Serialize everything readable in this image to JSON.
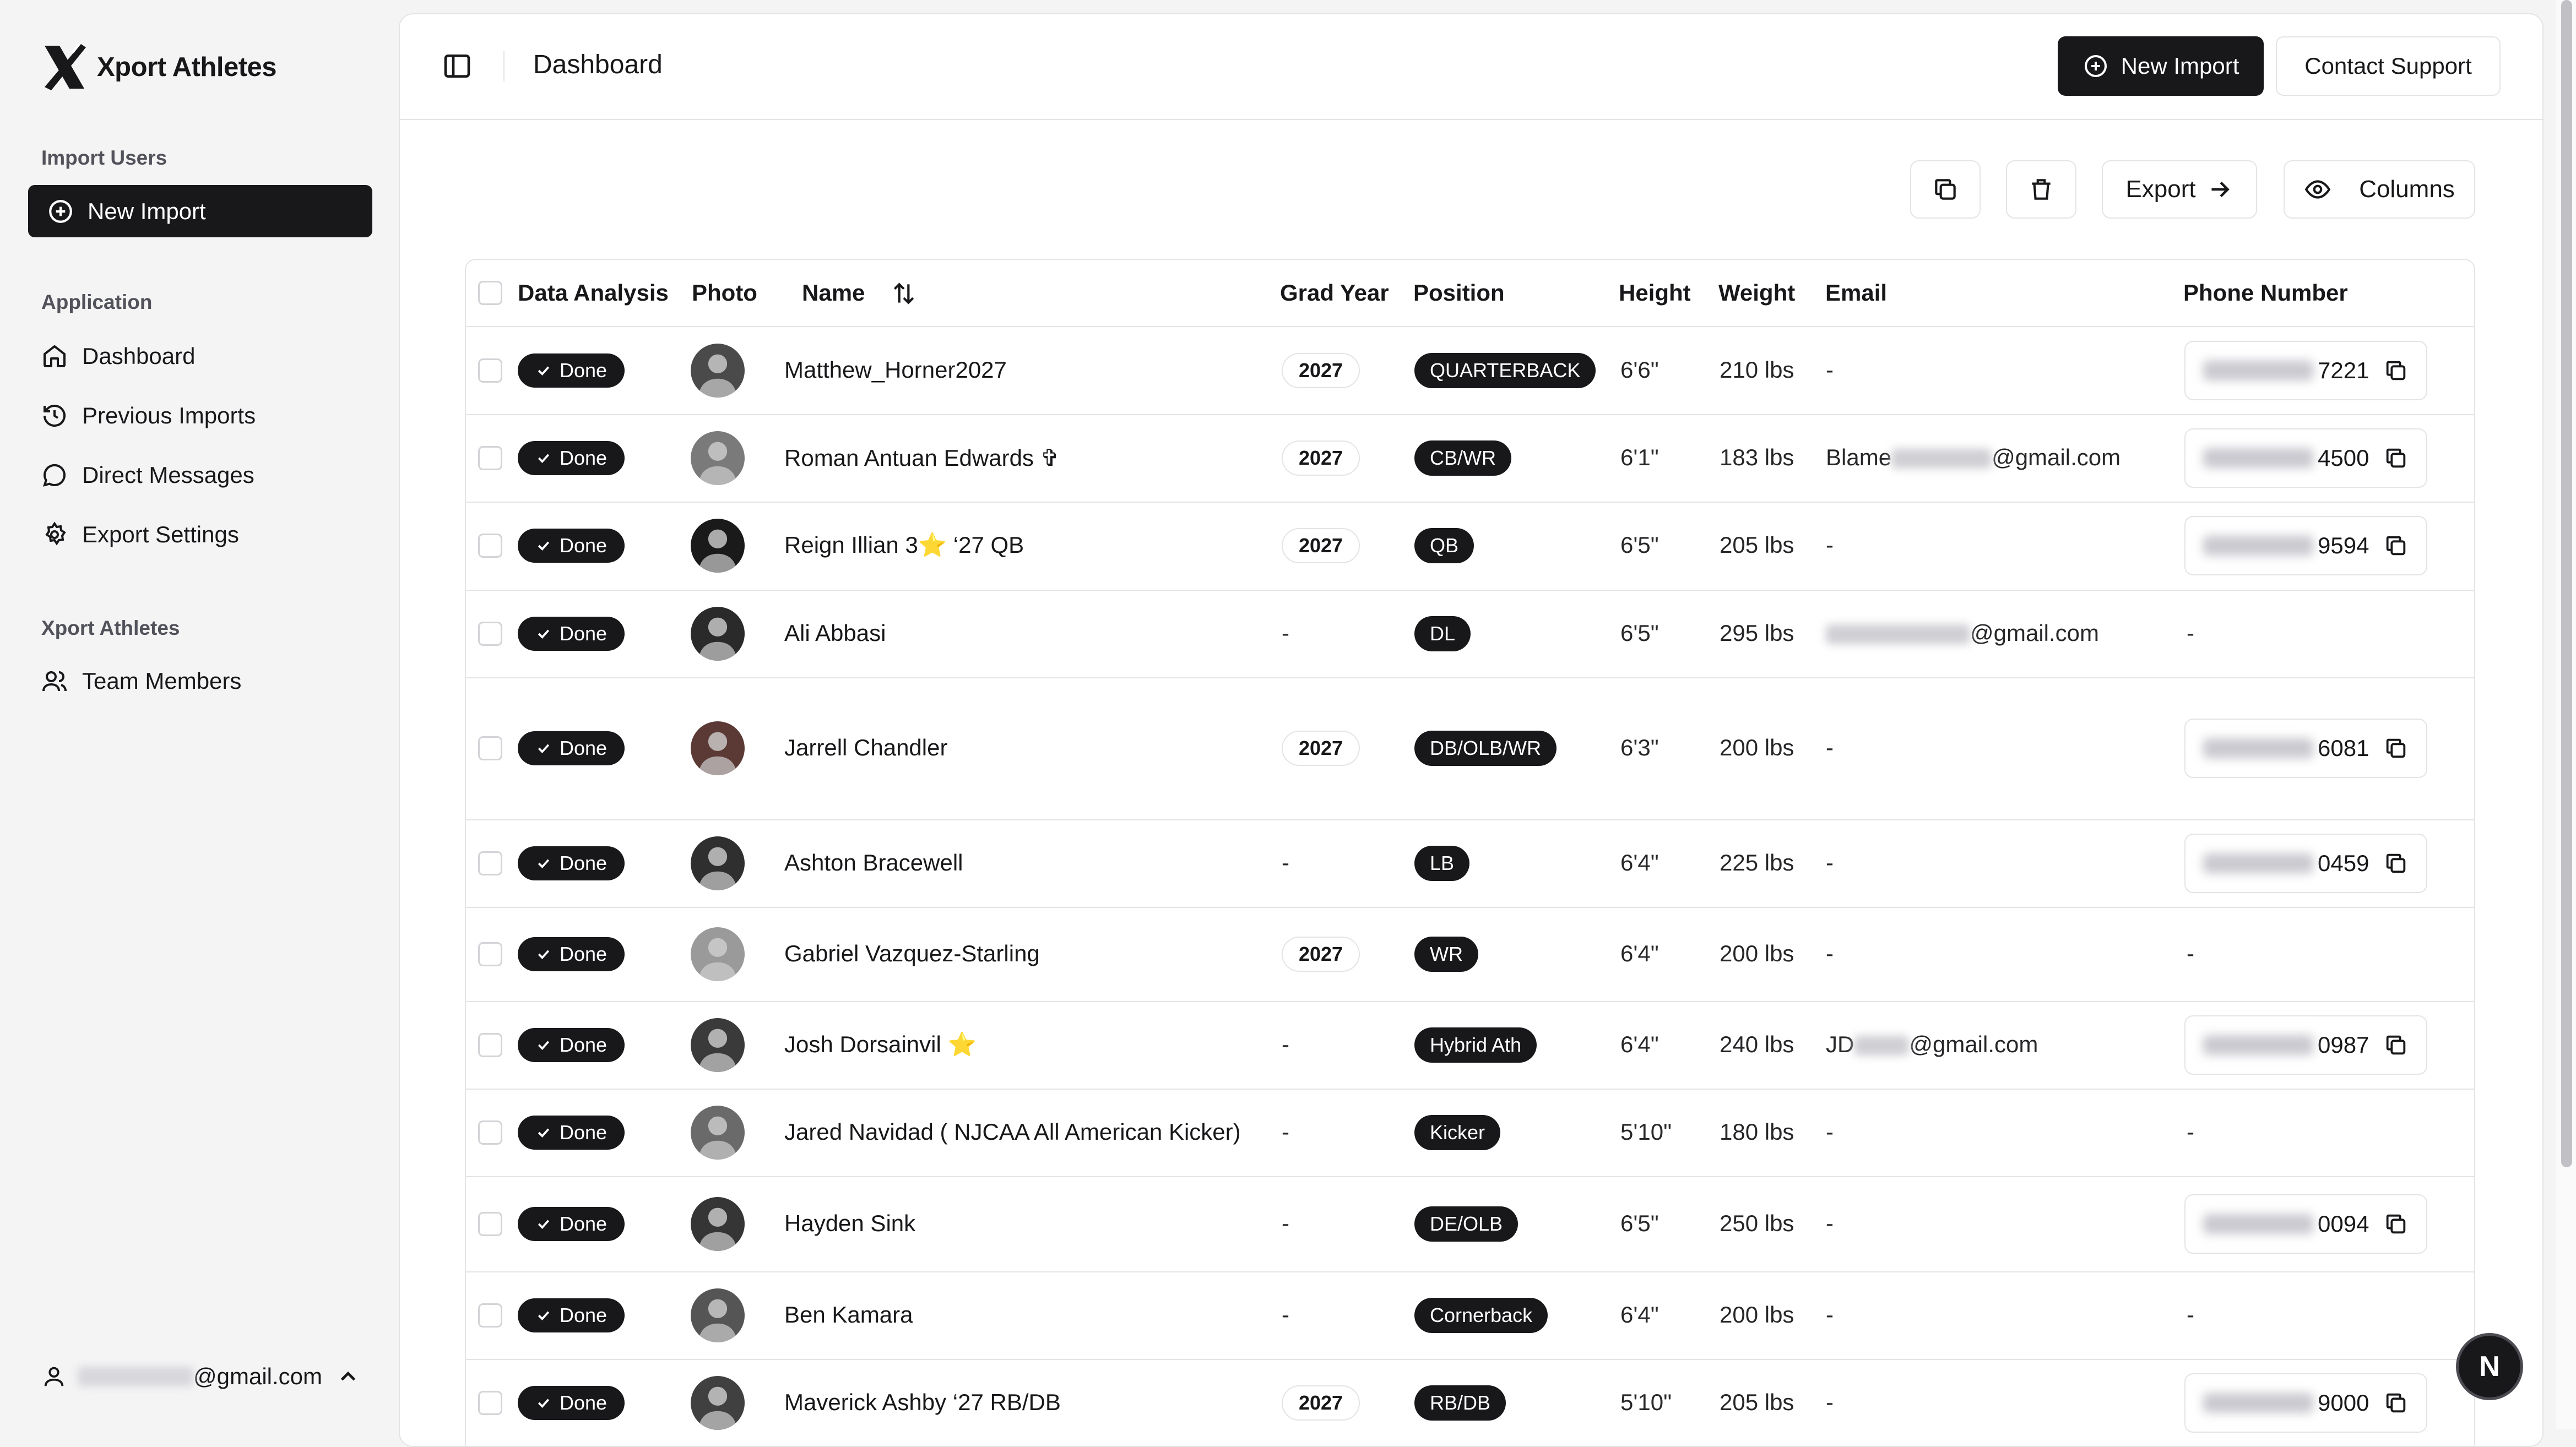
{
  "brand": {
    "name": "Xport Athletes"
  },
  "sidebar": {
    "import_section": "Import Users",
    "new_import": "New Import",
    "app_section": "Application",
    "items": [
      {
        "label": "Dashboard",
        "icon": "home-icon"
      },
      {
        "label": "Previous Imports",
        "icon": "history-icon"
      },
      {
        "label": "Direct Messages",
        "icon": "message-icon"
      },
      {
        "label": "Export Settings",
        "icon": "gear-icon"
      }
    ],
    "org_section": "Xport Athletes",
    "team_members": "Team Members",
    "user_email_suffix": "@gmail.com"
  },
  "header": {
    "title": "Dashboard",
    "new_import": "New Import",
    "contact_support": "Contact Support"
  },
  "toolbar": {
    "export": "Export",
    "columns": "Columns"
  },
  "table": {
    "columns": [
      "Data Analysis",
      "Photo",
      "Name",
      "Grad Year",
      "Position",
      "Height",
      "Weight",
      "Email",
      "Phone Number"
    ],
    "rows": [
      {
        "status": "Done",
        "name": "Matthew_Horner2027",
        "grad": "2027",
        "position": "QUARTERBACK",
        "height": "6'6\"",
        "weight": "210 lbs",
        "email_prefix": "-",
        "email_suffix": "",
        "phone_suffix": "7221"
      },
      {
        "status": "Done",
        "name": "Roman Antuan Edwards ✞",
        "grad": "2027",
        "position": "CB/WR",
        "height": "6'1\"",
        "weight": "183 lbs",
        "email_prefix": "Blame",
        "email_suffix": "@gmail.com",
        "phone_suffix": "4500"
      },
      {
        "status": "Done",
        "name": "Reign Illian 3⭐️ ‘27 QB",
        "grad": "2027",
        "position": "QB",
        "height": "6'5\"",
        "weight": "205 lbs",
        "email_prefix": "-",
        "email_suffix": "",
        "phone_suffix": "9594"
      },
      {
        "status": "Done",
        "name": "Ali Abbasi",
        "grad": "-",
        "position": "DL",
        "height": "6'5\"",
        "weight": "295 lbs",
        "email_prefix": "",
        "email_suffix": "@gmail.com",
        "phone_suffix": ""
      },
      {
        "status": "Done",
        "name": "Jarrell Chandler",
        "grad": "2027",
        "position": "DB/OLB/WR",
        "height": "6'3\"",
        "weight": "200 lbs",
        "email_prefix": "-",
        "email_suffix": "",
        "phone_suffix": "6081"
      },
      {
        "status": "Done",
        "name": "Ashton Bracewell",
        "grad": "-",
        "position": "LB",
        "height": "6'4\"",
        "weight": "225 lbs",
        "email_prefix": "-",
        "email_suffix": "",
        "phone_suffix": "0459"
      },
      {
        "status": "Done",
        "name": "Gabriel Vazquez-Starling",
        "grad": "2027",
        "position": "WR",
        "height": "6'4\"",
        "weight": "200 lbs",
        "email_prefix": "-",
        "email_suffix": "",
        "phone_suffix": ""
      },
      {
        "status": "Done",
        "name": "Josh Dorsainvil ⭐️",
        "grad": "-",
        "position": "Hybrid Ath",
        "height": "6'4\"",
        "weight": "240 lbs",
        "email_prefix": "JD",
        "email_suffix": "@gmail.com",
        "phone_suffix": "0987"
      },
      {
        "status": "Done",
        "name": "Jared Navidad ( NJCAA All American Kicker)",
        "grad": "-",
        "position": "Kicker",
        "height": "5'10\"",
        "weight": "180 lbs",
        "email_prefix": "-",
        "email_suffix": "",
        "phone_suffix": ""
      },
      {
        "status": "Done",
        "name": "Hayden Sink",
        "grad": "-",
        "position": "DE/OLB",
        "height": "6'5\"",
        "weight": "250 lbs",
        "email_prefix": "-",
        "email_suffix": "",
        "phone_suffix": "0094"
      },
      {
        "status": "Done",
        "name": "Ben Kamara",
        "grad": "-",
        "position": "Cornerback",
        "height": "6'4\"",
        "weight": "200 lbs",
        "email_prefix": "-",
        "email_suffix": "",
        "phone_suffix": ""
      },
      {
        "status": "Done",
        "name": "Maverick Ashby ‘27 RB/DB",
        "grad": "2027",
        "position": "RB/DB",
        "height": "5'10\"",
        "weight": "205 lbs",
        "email_prefix": "-",
        "email_suffix": "",
        "phone_suffix": "9000"
      }
    ]
  },
  "fab": {
    "label": "N"
  },
  "colors": {
    "primary": "#18181b",
    "border": "#e4e4e7",
    "background": "#f4f4f5"
  }
}
